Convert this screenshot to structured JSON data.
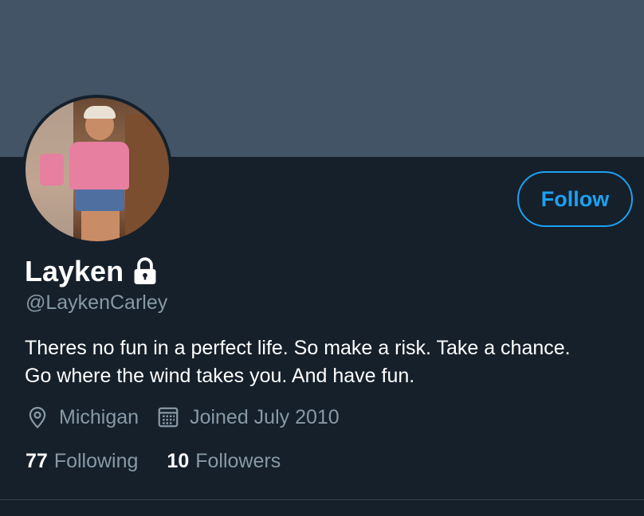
{
  "profile": {
    "name": "Layken",
    "handle": "@LaykenCarley",
    "bio": "Theres no fun in a perfect life. So make a risk. Take a chance. Go where the wind takes you. And have fun.",
    "location": "Michigan",
    "joined": "Joined July 2010",
    "protected_icon": "lock-icon",
    "location_icon": "location-pin-icon",
    "joined_icon": "calendar-icon"
  },
  "actions": {
    "follow_label": "Follow"
  },
  "stats": {
    "following_count": "77",
    "following_label": "Following",
    "followers_count": "10",
    "followers_label": "Followers"
  },
  "colors": {
    "background": "#15202b",
    "banner": "#425466",
    "accent": "#1da1f2",
    "secondary_text": "#8899a6"
  }
}
